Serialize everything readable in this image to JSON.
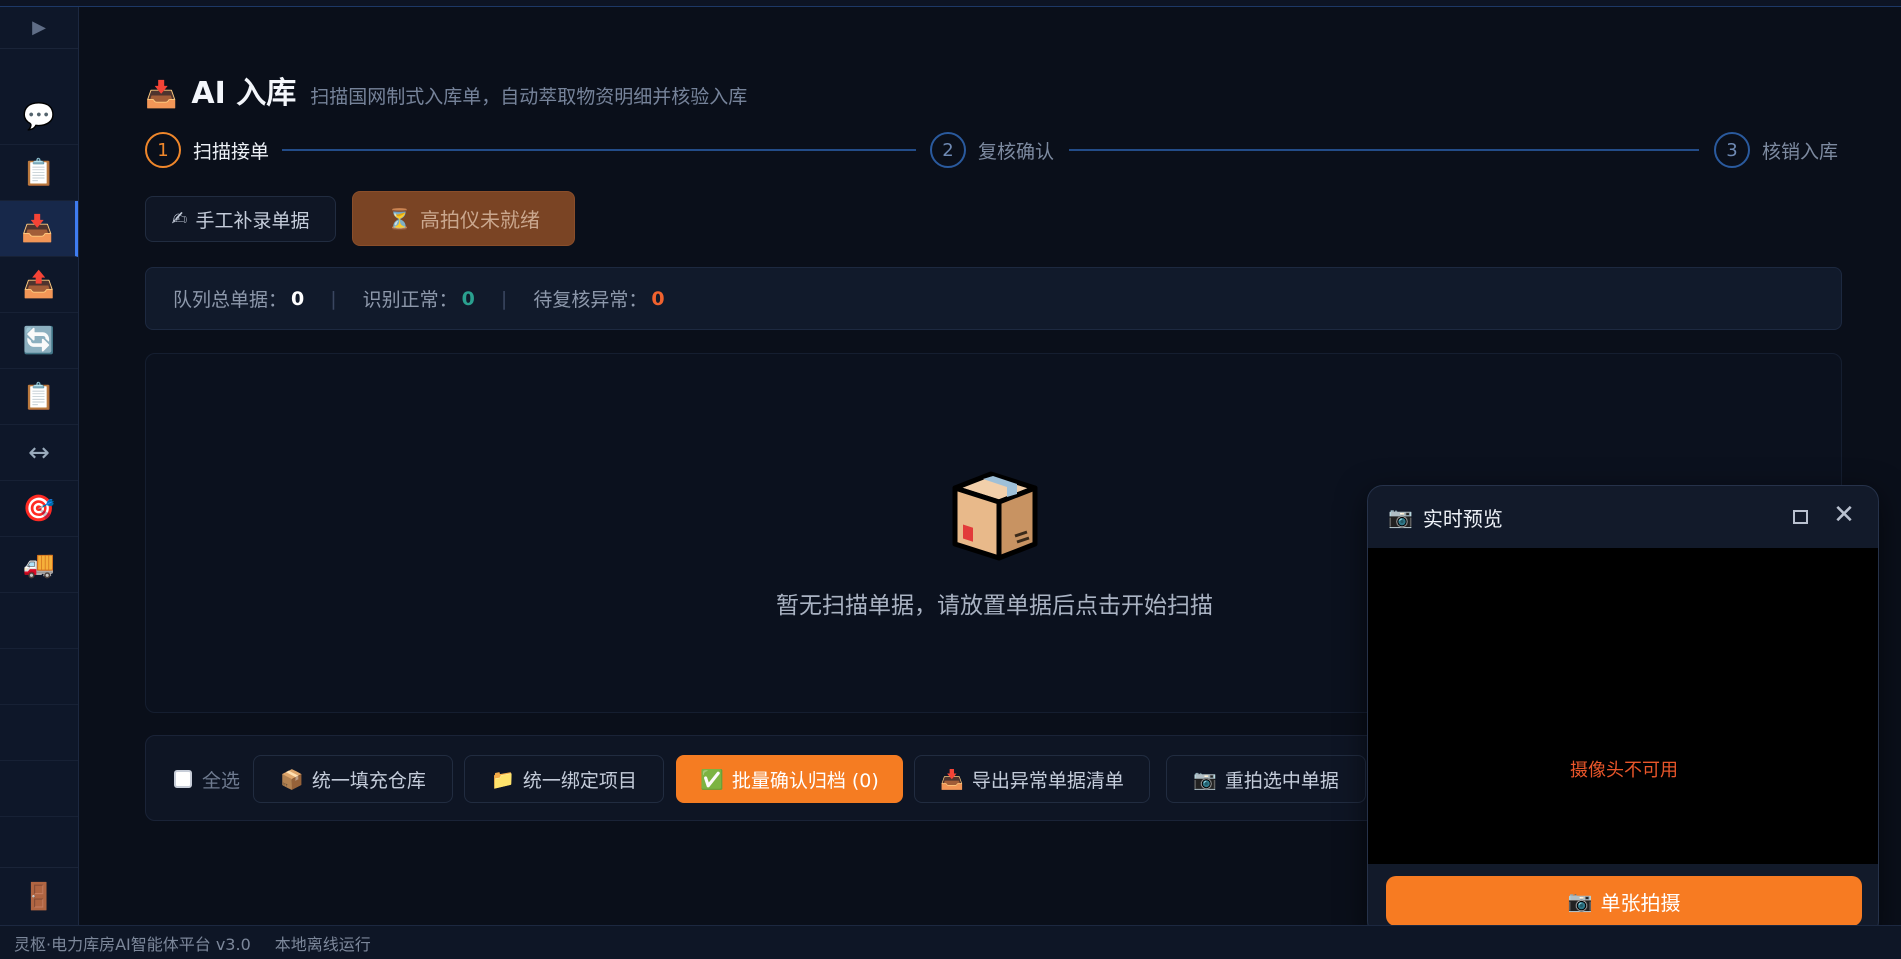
{
  "sidebar": {
    "toggle_icon": "▶",
    "items": [
      {
        "name": "chat",
        "icon": "💬",
        "active": false
      },
      {
        "name": "clipboard",
        "icon": "📋",
        "active": false
      },
      {
        "name": "inbox",
        "icon": "📥",
        "active": true
      },
      {
        "name": "outbox",
        "icon": "📤",
        "active": false
      },
      {
        "name": "sync",
        "icon": "🔄",
        "active": false
      },
      {
        "name": "clipboard-2",
        "icon": "📋",
        "active": false
      },
      {
        "name": "transfer",
        "icon": "↔",
        "active": false
      },
      {
        "name": "target",
        "icon": "🎯",
        "active": false
      },
      {
        "name": "truck",
        "icon": "🚚",
        "active": false
      }
    ],
    "bottom_icon": "🚪"
  },
  "header": {
    "icon": "📥",
    "title": "AI 入库",
    "subtitle": "扫描国网制式入库单，自动萃取物资明细并核验入库"
  },
  "stepper": {
    "steps": [
      {
        "num": "1",
        "label": "扫描接单",
        "active": true
      },
      {
        "num": "2",
        "label": "复核确认",
        "active": false
      },
      {
        "num": "3",
        "label": "核销入库",
        "active": false
      }
    ]
  },
  "actions": {
    "manual_icon": "✍",
    "manual_label": "手工补录单据",
    "scanner_icon": "⏳",
    "scanner_label": "高拍仪未就绪"
  },
  "stats": {
    "total_label": "队列总单据：",
    "total_value": "0",
    "ok_label": "识别正常：",
    "ok_value": "0",
    "abnormal_label": "待复核异常：",
    "abnormal_value": "0",
    "sep": "|"
  },
  "empty": {
    "icon": "📦",
    "text": "暂无扫描单据，请放置单据后点击开始扫描"
  },
  "bulk": {
    "select_all": "全选",
    "fill_warehouse_icon": "📦",
    "fill_warehouse": "统一填充仓库",
    "bind_project_icon": "📁",
    "bind_project": "统一绑定项目",
    "confirm_icon": "✅",
    "confirm_archive": "批量确认归档 (0)",
    "export_icon": "📥",
    "export_abnormal": "导出异常单据清单",
    "retake_icon": "📷",
    "retake": "重拍选中单据"
  },
  "preview": {
    "icon": "📷",
    "title": "实时预览",
    "close_icon": "✕",
    "error": "摄像头不可用",
    "capture_icon": "📷",
    "capture_label": "单张拍摄"
  },
  "statusbar": {
    "app": "灵枢·电力库房AI智能体平台 v3.0",
    "mode": "本地离线运行"
  }
}
